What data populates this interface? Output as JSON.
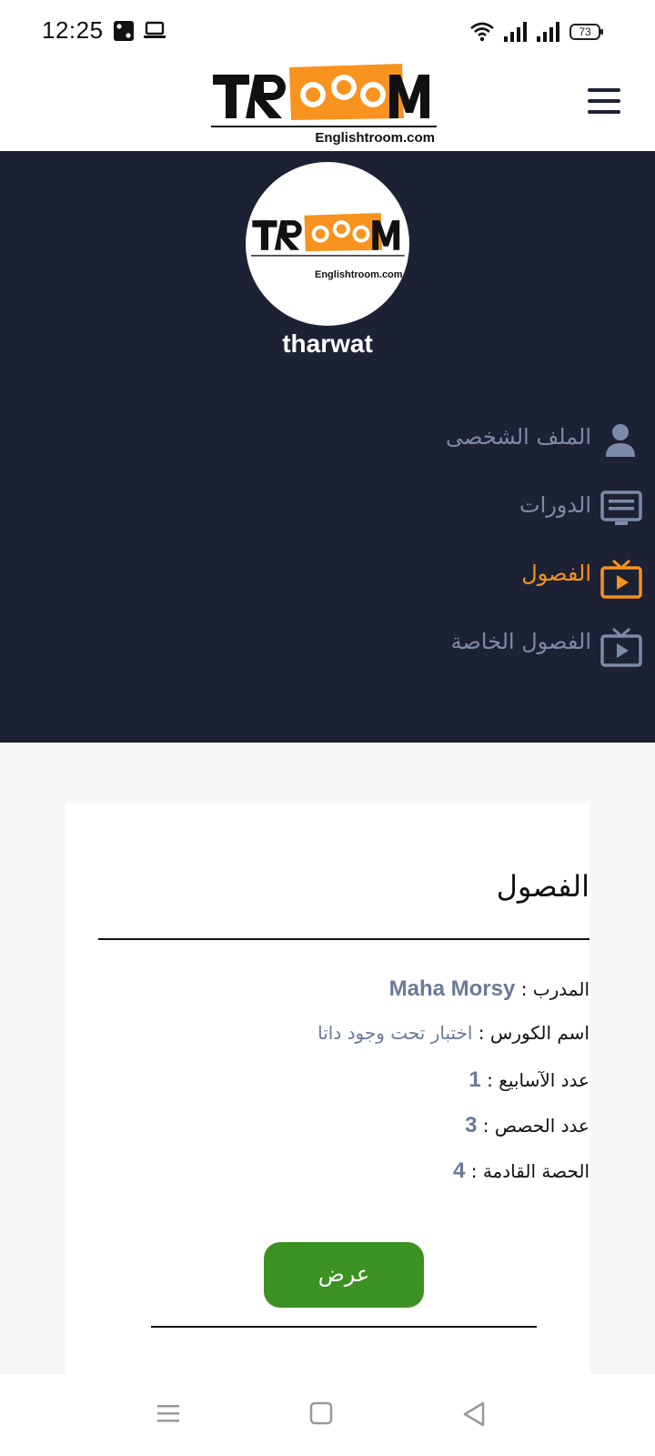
{
  "status_bar": {
    "time": "12:25",
    "battery": "73",
    "icons": [
      "dice-icon",
      "laptop-icon",
      "wifi-icon",
      "signal-icon",
      "signal-icon",
      "battery-icon"
    ]
  },
  "header": {
    "logo_text": "TROOM",
    "logo_domain": "Englishtroom.com",
    "menu_icon": "hamburger-menu-icon"
  },
  "profile": {
    "username": "tharwat",
    "avatar_logo_domain": "Englishtroom.com"
  },
  "nav": {
    "items": [
      {
        "label": "الملف الشخصى",
        "icon": "person-icon",
        "active": false
      },
      {
        "label": "الدورات",
        "icon": "monitor-icon",
        "active": false
      },
      {
        "label": "الفصول",
        "icon": "tv-play-icon",
        "active": true
      },
      {
        "label": "الفصول الخاصة",
        "icon": "tv-play-icon",
        "active": false
      }
    ]
  },
  "card": {
    "title": "الفصول",
    "rows": [
      {
        "label": "المدرب : ",
        "value": "Maha Morsy"
      },
      {
        "label": "اسم الكورس : ",
        "value": "اختبار تحت وجود داتا"
      },
      {
        "label": "عدد الآسابيع : ",
        "value": "1"
      },
      {
        "label": "عدد الحصص : ",
        "value": "3"
      },
      {
        "label": "الحصة القادمة : ",
        "value": "4"
      }
    ],
    "button_label": "عرض"
  },
  "colors": {
    "panel_bg": "#1d2134",
    "accent_orange": "#f7931e",
    "nav_text": "#7d8aa8",
    "button_green": "#3b9121",
    "value_text": "#6b7a99"
  }
}
